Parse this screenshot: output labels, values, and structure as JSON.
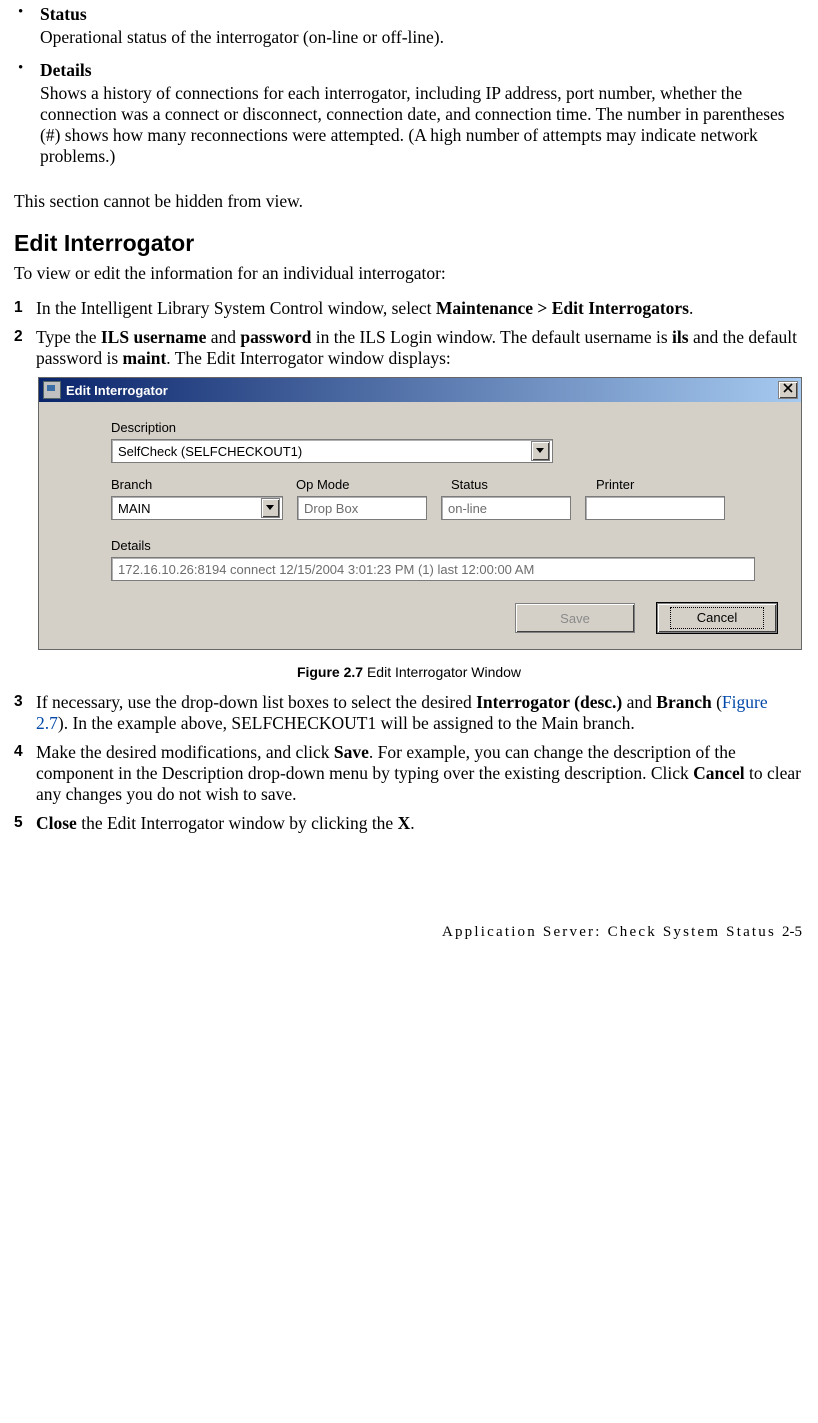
{
  "bullets": {
    "status": {
      "head": "Status",
      "body": "Operational status of the interrogator (on-line or off-line)."
    },
    "details": {
      "head": "Details",
      "body": "Shows a history of connections for each interrogator, including IP address, port number, whether the connection was a connect or disconnect, connection date, and connection time. The number in parentheses (#) shows how many reconnections were attempted. (A high number of attempts may indicate network problems.)"
    }
  },
  "hidden_note": "This section cannot be hidden from view.",
  "section_heading": "Edit Interrogator",
  "section_intro": "To view or edit the information for an individual interrogator:",
  "steps": {
    "s1": {
      "num": "1",
      "pre": "In the Intelligent Library System Control window, select ",
      "bold": "Maintenance > Edit Interrogators",
      "post": "."
    },
    "s2": {
      "num": "2",
      "t1": "Type the ",
      "b1": "ILS username",
      "t2": " and ",
      "b2": "password",
      "t3": " in the ILS Login window. The default username is ",
      "b3": "ils",
      "t4": " and the default password is ",
      "b4": "maint",
      "t5": ". The Edit Interrogator window displays:"
    },
    "s3": {
      "num": "3",
      "t1": "If necessary, use the drop-down list boxes to select the desired ",
      "b1": "Interrogator (desc.)",
      "t2": " and ",
      "b2": "Branch",
      "t3": " (",
      "link": "Figure 2.7",
      "t4": "). In the example above, SELFCHECKOUT1 will be assigned to the Main branch."
    },
    "s4": {
      "num": "4",
      "t1": "Make the desired modifications, and click ",
      "b1": "Save",
      "t2": ". For example, you can change the description of the component in the Description drop-down menu by typing over the existing description. Click ",
      "b2": "Cancel",
      "t3": " to clear any changes you do not wish to save."
    },
    "s5": {
      "num": "5",
      "b1": "Close",
      "t1": " the Edit Interrogator window by clicking the ",
      "b2": "X",
      "t2": "."
    }
  },
  "window": {
    "title": "Edit Interrogator",
    "close_x": "X",
    "labels": {
      "description": "Description",
      "branch": "Branch",
      "opmode": "Op Mode",
      "status": "Status",
      "printer": "Printer",
      "details": "Details"
    },
    "values": {
      "description": "SelfCheck (SELFCHECKOUT1)",
      "branch": "MAIN",
      "opmode": "Drop Box",
      "status": "on-line",
      "printer": "",
      "details_line": "172.16.10.26:8194 connect 12/15/2004 3:01:23 PM (1) last 12:00:00 AM"
    },
    "buttons": {
      "save": "Save",
      "cancel": "Cancel"
    }
  },
  "figure": {
    "label": "Figure 2.7",
    "caption": " Edit Interrogator Window"
  },
  "footer": {
    "text": "Application Server: Check System Status ",
    "pagenum": "2-5"
  }
}
